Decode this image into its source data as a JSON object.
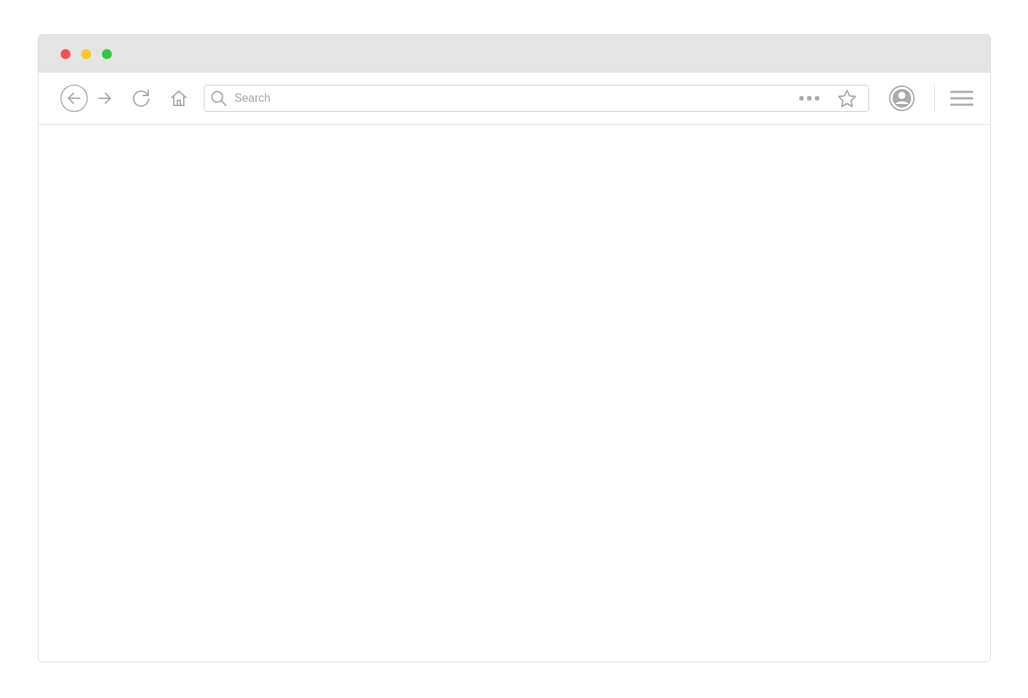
{
  "window": {
    "traffic_lights": [
      {
        "color": "#f05252"
      },
      {
        "color": "#f7ca2d"
      },
      {
        "color": "#32c840"
      }
    ]
  },
  "search": {
    "placeholder": "Search"
  }
}
